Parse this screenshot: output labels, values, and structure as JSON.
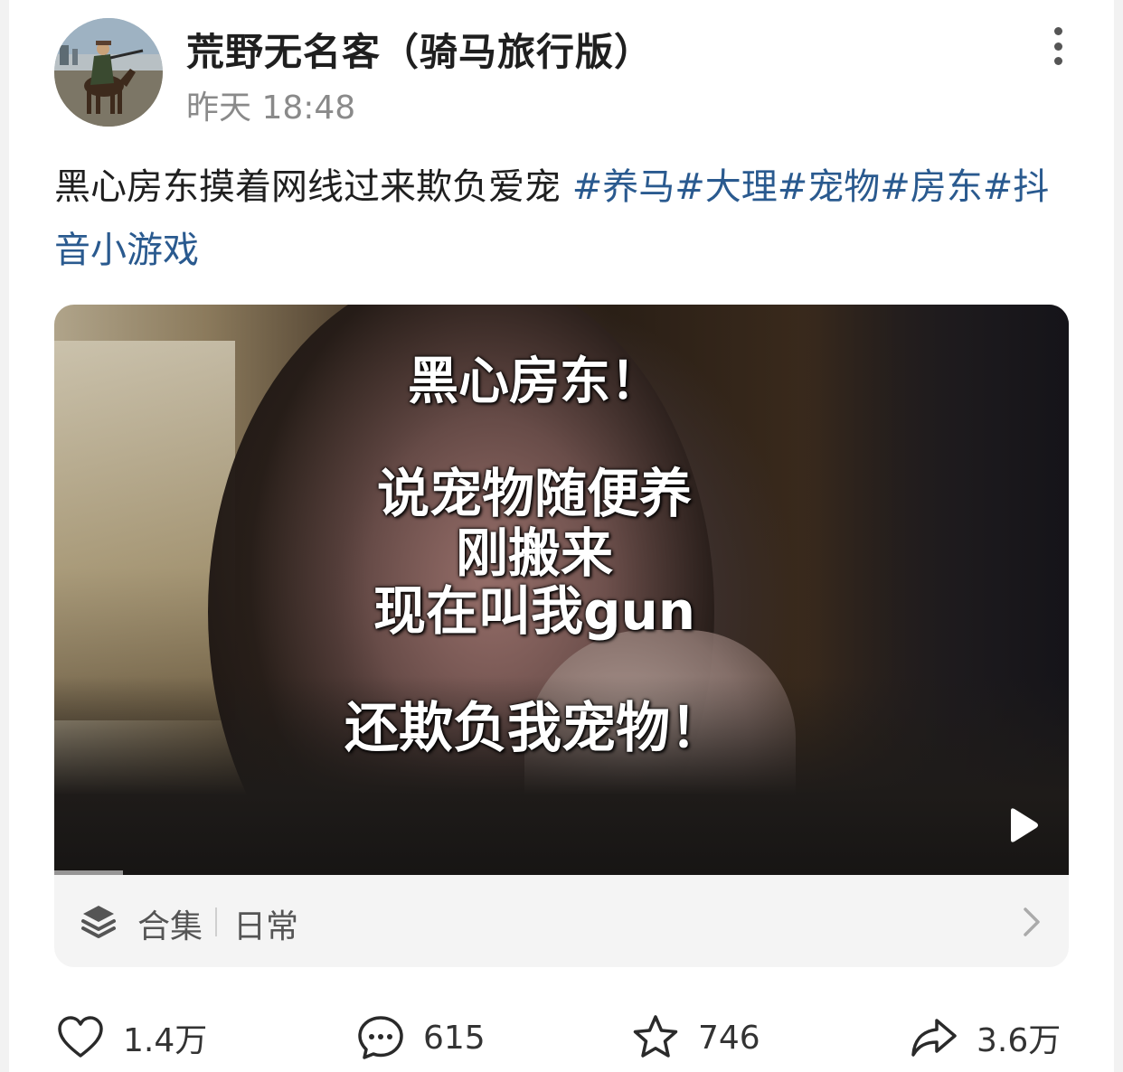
{
  "author": {
    "name": "荒野无名客（骑马旅行版）",
    "time": "昨天 18:48",
    "avatar_icon": "horse-rider-avatar"
  },
  "post": {
    "text_plain": "黑心房东摸着网线过来欺负爱宠 ",
    "tags": [
      "#养马",
      "#大理",
      "#宠物",
      "#房东",
      "#抖音小游戏"
    ],
    "tag_color": "#2a5a8f"
  },
  "video": {
    "overlay": {
      "line1": "黑心房东！",
      "line2": "说宠物随便养",
      "line3": "刚搬来",
      "line4": "现在叫我gun",
      "line5": "还欺负我宠物！"
    },
    "play_icon": "play-icon"
  },
  "collection": {
    "label": "合集",
    "name": "日常",
    "icon": "layers-icon"
  },
  "actions": {
    "likes": "1.4万",
    "comments": "615",
    "favorites": "746",
    "shares": "3.6万"
  }
}
